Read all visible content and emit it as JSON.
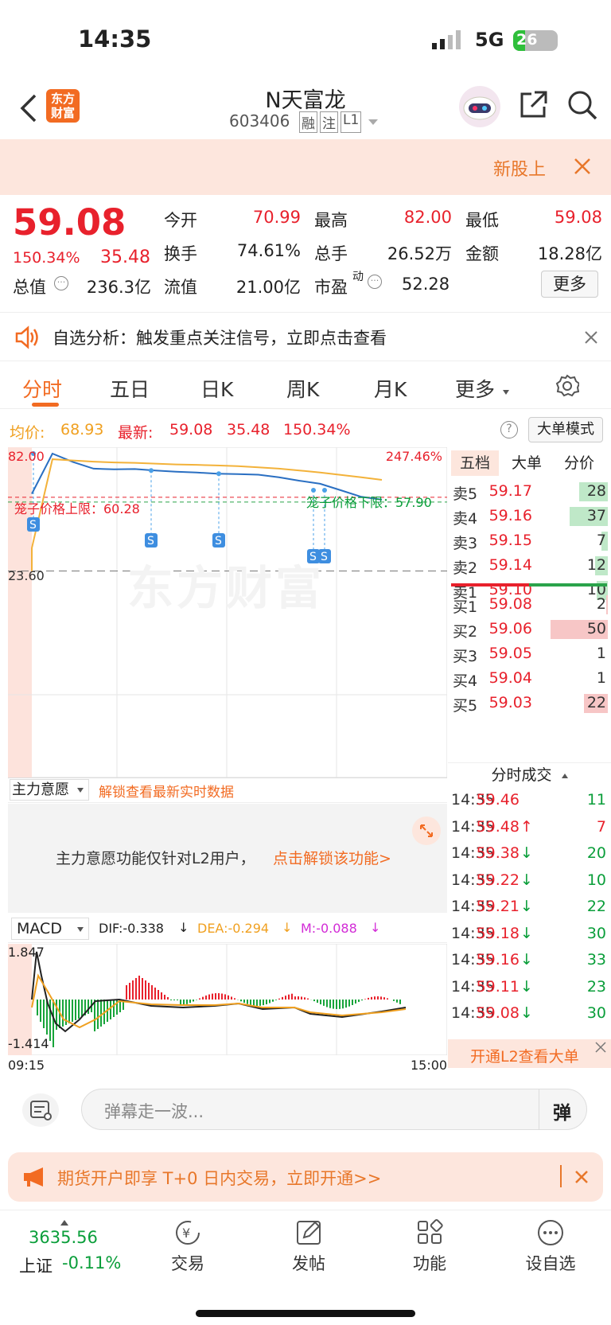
{
  "status": {
    "time": "14:35",
    "network": "5G",
    "battery": "26"
  },
  "nav": {
    "title": "N天富龙",
    "code": "603406",
    "badges": [
      "融",
      "注",
      "L1"
    ],
    "logo": "东方财富"
  },
  "banner": {
    "text": "新股上"
  },
  "quote": {
    "price": "59.08",
    "pct": "150.34%",
    "change": "35.48",
    "rows": [
      [
        {
          "label": "今开",
          "value": "70.99",
          "color": "red"
        },
        {
          "label": "最高",
          "value": "82.00",
          "color": "red"
        },
        {
          "label": "最低",
          "value": "59.08",
          "color": "red"
        }
      ],
      [
        {
          "label": "换手",
          "value": "74.61%",
          "color": "black"
        },
        {
          "label": "总手",
          "value": "26.52万",
          "color": "black"
        },
        {
          "label": "金额",
          "value": "18.28亿",
          "color": "black"
        }
      ],
      [
        {
          "label": "总值",
          "value": "236.3亿",
          "color": "black"
        },
        {
          "label": "流值",
          "value": "21.00亿",
          "color": "black"
        },
        {
          "label": "市盈",
          "value": "52.28",
          "color": "black"
        }
      ]
    ],
    "pe_sup": "动",
    "more": "更多"
  },
  "notice": {
    "text": "自选分析：触发重点关注信号，立即点击查看"
  },
  "tabs": [
    "分时",
    "五日",
    "日K",
    "周K",
    "月K",
    "更多"
  ],
  "infobar": {
    "avg_label": "均价:",
    "avg": "68.93",
    "latest_label": "最新:",
    "latest": "59.08",
    "change": "35.48",
    "pct": "150.34%",
    "mode": "大单模式"
  },
  "chart": {
    "high": "82.00",
    "low": "23.60",
    "pct_high": "247.46%",
    "upper_limit": "笼子价格上限：60.28",
    "lower_limit": "笼子价格下限：57.90",
    "watermark": "东方财富",
    "s_label": "S"
  },
  "chart_data": {
    "type": "line",
    "x": [
      "09:30",
      "09:35",
      "09:40",
      "09:50",
      "10:00",
      "10:15",
      "10:30",
      "10:45",
      "11:00",
      "11:15",
      "11:30",
      "13:15",
      "13:30",
      "13:45",
      "14:00",
      "14:15",
      "14:25",
      "14:35"
    ],
    "series": [
      {
        "name": "最新",
        "values": [
          62.0,
          82.0,
          77.8,
          74.5,
          74.2,
          74.3,
          73.6,
          73.0,
          72.6,
          72.0,
          71.8,
          71.5,
          70.2,
          68.5,
          67.0,
          63.8,
          60.5,
          59.08
        ]
      },
      {
        "name": "均价",
        "values": [
          35.0,
          79.2,
          78.6,
          78.0,
          77.6,
          77.4,
          77.0,
          76.6,
          76.4,
          76.1,
          75.8,
          75.2,
          74.5,
          73.6,
          72.6,
          71.4,
          70.2,
          68.93
        ]
      }
    ],
    "ylim": [
      23.6,
      82.0
    ],
    "x_start": "09:15",
    "x_end": "15:00"
  },
  "book": {
    "tabs": [
      "五档",
      "大单",
      "分价"
    ],
    "asks": [
      {
        "label": "卖5",
        "price": "59.17",
        "vol": "28",
        "bar": 0.45
      },
      {
        "label": "卖4",
        "price": "59.16",
        "vol": "37",
        "bar": 0.6
      },
      {
        "label": "卖3",
        "price": "59.15",
        "vol": "7",
        "bar": 0.1
      },
      {
        "label": "卖2",
        "price": "59.14",
        "vol": "12",
        "bar": 0.2
      },
      {
        "label": "卖1",
        "price": "59.10",
        "vol": "10",
        "bar": 0.17
      }
    ],
    "bids": [
      {
        "label": "买1",
        "price": "59.08",
        "vol": "2",
        "bar": 0.03
      },
      {
        "label": "买2",
        "price": "59.06",
        "vol": "50",
        "bar": 0.9
      },
      {
        "label": "买3",
        "price": "59.05",
        "vol": "1",
        "bar": 0.0
      },
      {
        "label": "买4",
        "price": "59.04",
        "vol": "1",
        "bar": 0.0
      },
      {
        "label": "买5",
        "price": "59.03",
        "vol": "22",
        "bar": 0.38
      }
    ]
  },
  "l2": {
    "selector": "主力意愿",
    "unlock_hint": "解锁查看最新实时数据",
    "msg": "主力意愿功能仅针对L2用户，",
    "link": "点击解锁该功能>"
  },
  "macd": {
    "selector": "MACD",
    "dif": "DIF:-0.338",
    "dea": "DEA:-0.294",
    "m": "M:-0.088",
    "max": "1.847",
    "min": "-1.414",
    "start": "09:15",
    "end": "15:00"
  },
  "trades": {
    "title": "分时成交",
    "rows": [
      {
        "time": "14:35",
        "price": "59.46",
        "arrow": "",
        "vol": "11",
        "color": "green"
      },
      {
        "time": "14:35",
        "price": "59.48",
        "arrow": "↑",
        "vol": "7",
        "color": "red"
      },
      {
        "time": "14:35",
        "price": "59.38",
        "arrow": "↓",
        "vol": "20",
        "color": "green"
      },
      {
        "time": "14:35",
        "price": "59.22",
        "arrow": "↓",
        "vol": "10",
        "color": "green"
      },
      {
        "time": "14:35",
        "price": "59.21",
        "arrow": "↓",
        "vol": "22",
        "color": "green"
      },
      {
        "time": "14:35",
        "price": "59.18",
        "arrow": "↓",
        "vol": "30",
        "color": "green"
      },
      {
        "time": "14:35",
        "price": "59.16",
        "arrow": "↓",
        "vol": "33",
        "color": "green"
      },
      {
        "time": "14:35",
        "price": "59.11",
        "arrow": "↓",
        "vol": "23",
        "color": "green"
      },
      {
        "time": "14:35",
        "price": "59.08",
        "arrow": "↓",
        "vol": "30",
        "color": "green"
      }
    ],
    "cta": "开通L2查看大单"
  },
  "bullet": {
    "placeholder": "弹幕走一波...",
    "send": "弹"
  },
  "ad": {
    "text": "期货开户即享 T+0 日内交易，立即开通>>"
  },
  "bottom": {
    "index_value": "3635.56",
    "index_name": "上证",
    "index_pct": "-0.11%",
    "items": [
      "交易",
      "发帖",
      "功能",
      "设自选"
    ]
  }
}
